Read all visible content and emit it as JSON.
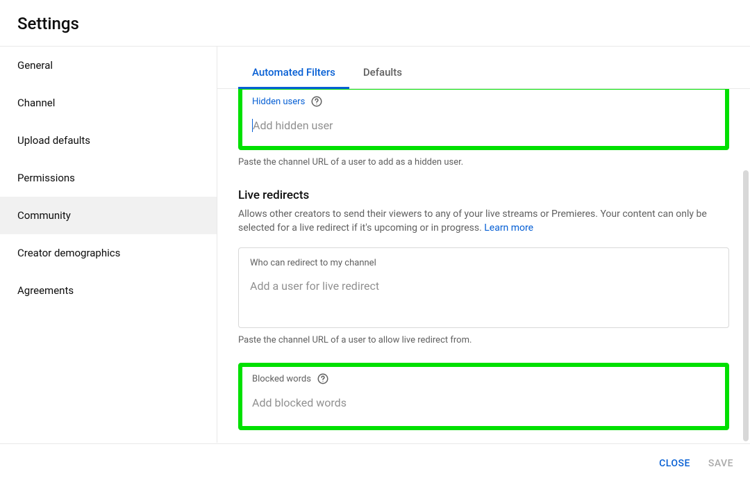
{
  "header": {
    "title": "Settings"
  },
  "sidebar": {
    "items": [
      {
        "label": "General"
      },
      {
        "label": "Channel"
      },
      {
        "label": "Upload defaults"
      },
      {
        "label": "Permissions"
      },
      {
        "label": "Community"
      },
      {
        "label": "Creator demographics"
      },
      {
        "label": "Agreements"
      }
    ]
  },
  "tabs": {
    "automated_filters": "Automated Filters",
    "defaults": "Defaults"
  },
  "hidden_users": {
    "label": "Hidden users",
    "placeholder": "Add hidden user",
    "helper": "Paste the channel URL of a user to add as a hidden user."
  },
  "live_redirects": {
    "title": "Live redirects",
    "description": "Allows other creators to send their viewers to any of your live streams or Premieres. Your content can only be selected for a live redirect if it's upcoming or in progress. ",
    "learn_more": "Learn more",
    "field_label": "Who can redirect to my channel",
    "placeholder": "Add a user for live redirect",
    "helper": "Paste the channel URL of a user to allow live redirect from."
  },
  "blocked_words": {
    "label": "Blocked words",
    "placeholder": "Add blocked words"
  },
  "footer": {
    "close": "CLOSE",
    "save": "SAVE"
  }
}
